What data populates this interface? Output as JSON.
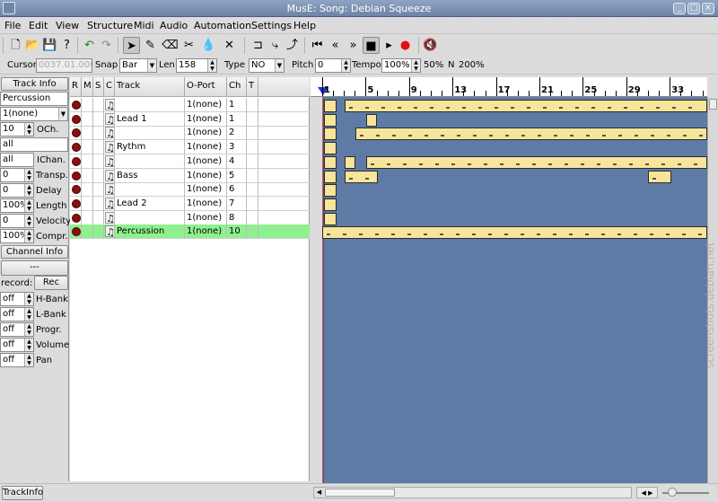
{
  "window": {
    "title": "MusE: Song: Debian Squeeze"
  },
  "menu": [
    "File",
    "Edit",
    "View",
    "Structure",
    "Midi",
    "Audio",
    "Automation",
    "Settings",
    "Help"
  ],
  "toolbar": {
    "cursor_label": "Cursor",
    "cursor_value": "0037.01.000",
    "snap_label": "Snap",
    "snap_value": "Bar",
    "len_label": "Len",
    "len_value": "158",
    "type_label": "Type",
    "type_value": "NO",
    "pitch_label": "Pitch",
    "pitch_value": "0",
    "tempo_label": "Tempo",
    "tempo_value": "100%",
    "pct50": "50%",
    "n_label": "N",
    "pct200": "200%"
  },
  "trackinfo": {
    "header": "Track Info",
    "name": "Percussion",
    "output": "1(none)",
    "och_value": "10",
    "och_label": "OCh.",
    "ich_value1": "all",
    "ich_value2": "all",
    "ich_label": "IChan.",
    "params": [
      {
        "value": "0",
        "label": "Transp."
      },
      {
        "value": "0",
        "label": "Delay"
      },
      {
        "value": "100%",
        "label": "Length"
      },
      {
        "value": "0",
        "label": "Velocity"
      },
      {
        "value": "100%",
        "label": "Compr."
      }
    ],
    "channel_header": "Channel Info",
    "dash": "---",
    "record_label": "record:",
    "rec_button": "Rec",
    "ctrls": [
      {
        "value": "off",
        "label": "H-Bank"
      },
      {
        "value": "off",
        "label": "L-Bank"
      },
      {
        "value": "off",
        "label": "Progr."
      },
      {
        "value": "off",
        "label": "Volume"
      },
      {
        "value": "off",
        "label": "Pan"
      }
    ]
  },
  "tracklist": {
    "headers": [
      "R",
      "M",
      "S",
      "C",
      "Track",
      "O-Port",
      "Ch",
      "T"
    ],
    "rows": [
      {
        "name": "",
        "port": "1(none)",
        "ch": "1"
      },
      {
        "name": "Lead 1",
        "port": "1(none)",
        "ch": "1"
      },
      {
        "name": "",
        "port": "1(none)",
        "ch": "2"
      },
      {
        "name": "Rythm",
        "port": "1(none)",
        "ch": "3"
      },
      {
        "name": "",
        "port": "1(none)",
        "ch": "4"
      },
      {
        "name": "Bass",
        "port": "1(none)",
        "ch": "5"
      },
      {
        "name": "",
        "port": "1(none)",
        "ch": "6"
      },
      {
        "name": "Lead 2",
        "port": "1(none)",
        "ch": "7"
      },
      {
        "name": "",
        "port": "1(none)",
        "ch": "8"
      },
      {
        "name": "Percussion",
        "port": "1(none)",
        "ch": "10"
      }
    ],
    "selected_row": 9
  },
  "ruler": {
    "bars": [
      "1",
      "5",
      "9",
      "13",
      "17",
      "21",
      "25",
      "29",
      "33"
    ]
  },
  "bottom": {
    "trackinfo_button": "TrackInfo"
  },
  "watermark": "screenshots.debian.net",
  "colors": {
    "canvas": "#5e7ba6",
    "part": "#f7e59a",
    "selected_row": "#8ff08f"
  }
}
